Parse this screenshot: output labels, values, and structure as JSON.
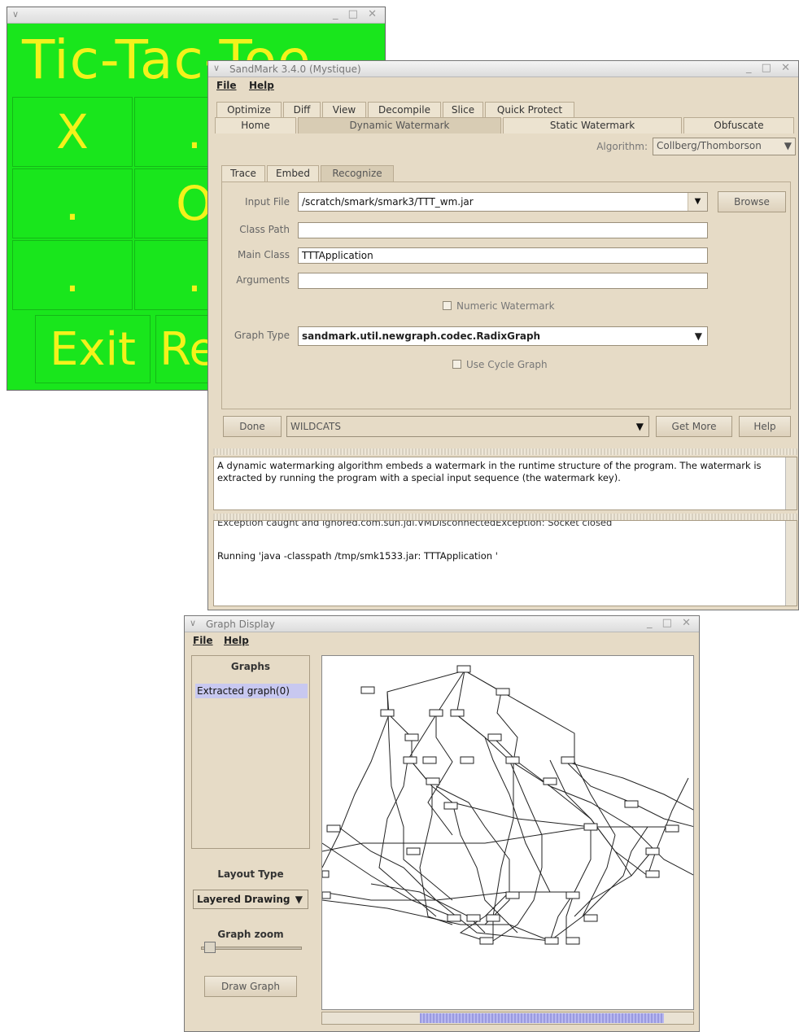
{
  "tictactoe": {
    "title": "Tic-Tac-Toe",
    "cells": [
      "X",
      ".",
      ".",
      "O",
      ".",
      "."
    ],
    "buttons": [
      "Exit",
      "Re"
    ]
  },
  "sandmark": {
    "title": "SandMark 3.4.0 (Mystique)",
    "menu": [
      "File",
      "Help"
    ],
    "tabs_row1": [
      "Optimize",
      "Diff",
      "View",
      "Decompile",
      "Slice",
      "Quick Protect"
    ],
    "tabs_row2": [
      "Home",
      "Dynamic Watermark",
      "Static Watermark",
      "Obfuscate"
    ],
    "algorithm_label": "Algorithm:",
    "algorithm_value": "Collberg/Thomborson",
    "subtabs": [
      "Trace",
      "Embed",
      "Recognize"
    ],
    "input_file_label": "Input File",
    "input_file_value": "/scratch/smark/smark3/TTT_wm.jar",
    "browse_label": "Browse",
    "class_path_label": "Class Path",
    "class_path_value": "",
    "main_class_label": "Main Class",
    "main_class_value": "TTTApplication",
    "arguments_label": "Arguments",
    "arguments_value": "",
    "numeric_watermark_label": "Numeric Watermark",
    "graph_type_label": "Graph Type",
    "graph_type_value": "sandmark.util.newgraph.codec.RadixGraph",
    "use_cycle_graph_label": "Use Cycle Graph",
    "done_label": "Done",
    "key_value": "WILDCATS",
    "get_more_label": "Get More",
    "help_label": "Help",
    "description": "A dynamic watermarking algorithm embeds a watermark in the runtime structure of the program. The watermark is extracted by running the program with a special input sequence (the watermark key).",
    "log_line1": "Exception caught and ignored.com.sun.jdi.VMDisconnectedException: Socket closed",
    "log_line2": "Running 'java -classpath /tmp/smk1533.jar: TTTApplication '"
  },
  "graph_display": {
    "title": "Graph Display",
    "menu": [
      "File",
      "Help"
    ],
    "graphs_header": "Graphs",
    "graph_item": "Extracted graph(0)",
    "layout_type_label": "Layout Type",
    "layout_value": "Layered Drawing",
    "graph_zoom_label": "Graph zoom",
    "draw_graph_label": "Draw Graph"
  }
}
